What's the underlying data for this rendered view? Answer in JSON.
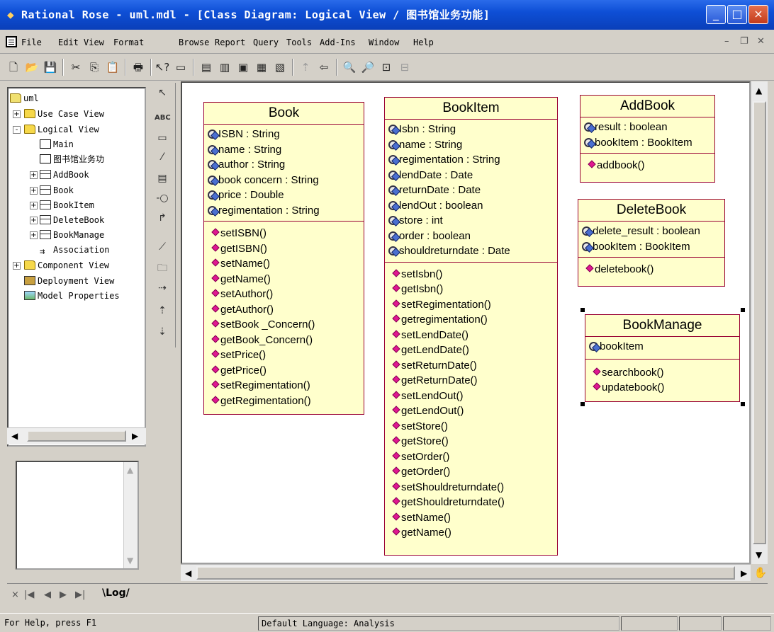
{
  "window": {
    "title": "Rational Rose - uml.mdl - [Class Diagram: Logical View / 图书馆业务功能]",
    "minimize": "_",
    "maximize": "□",
    "close": "×"
  },
  "menu": [
    "File",
    "Edit",
    "View",
    "Format",
    "Browse",
    "Report",
    "Query",
    "Tools",
    "Add-Ins",
    "Window",
    "Help"
  ],
  "toolbar_icons": [
    "new-icon",
    "open-icon",
    "save-icon",
    "cut-icon",
    "copy-icon",
    "paste-icon",
    "print-icon",
    "context-help-icon",
    "view-doc-icon",
    "browse-class-diagram-icon",
    "browse-interaction-diagram-icon",
    "browse-component-diagram-icon",
    "browse-deployment-diagram-icon",
    "browse-parent-icon",
    "browse-previous-icon",
    "zoom-in-icon",
    "zoom-out-icon",
    "fit-window-icon",
    "undo-fit-icon"
  ],
  "tree": {
    "root": "uml",
    "items": [
      {
        "label": "Use Case View",
        "type": "folder",
        "level": 1,
        "expander": "+"
      },
      {
        "label": "Logical View",
        "type": "folder",
        "level": 1,
        "expander": "-"
      },
      {
        "label": "Main",
        "type": "diagram",
        "level": 2
      },
      {
        "label": "图书馆业务功",
        "type": "diagram",
        "level": 2
      },
      {
        "label": "AddBook",
        "type": "class",
        "level": 2,
        "expander": "+"
      },
      {
        "label": "Book",
        "type": "class",
        "level": 2,
        "expander": "+"
      },
      {
        "label": "BookItem",
        "type": "class",
        "level": 2,
        "expander": "+"
      },
      {
        "label": "DeleteBook",
        "type": "class",
        "level": 2,
        "expander": "+"
      },
      {
        "label": "BookManage",
        "type": "class",
        "level": 2,
        "expander": "+"
      },
      {
        "label": "Association",
        "type": "association",
        "level": 2
      },
      {
        "label": "Component View",
        "type": "folder",
        "level": 1,
        "expander": "+"
      },
      {
        "label": "Deployment View",
        "type": "deploy",
        "level": 1
      },
      {
        "label": "Model Properties",
        "type": "props",
        "level": 1
      }
    ]
  },
  "palette": [
    "selection-arrow-icon",
    "text-tool-icon",
    "note-icon",
    "anchor-note-icon",
    "class-tool-icon",
    "interface-tool-icon",
    "unidirectional-association-icon",
    "association-class-icon",
    "package-tool-icon",
    "dependency-icon",
    "generalization-icon",
    "realization-icon"
  ],
  "classes": {
    "book": {
      "name": "Book",
      "attributes": [
        "ISBN : String",
        "name : String",
        "author : String",
        "book concern : String",
        "price : Double",
        "regimentation : String"
      ],
      "operations": [
        "setISBN()",
        "getISBN()",
        "setName()",
        "getName()",
        "setAuthor()",
        "getAuthor()",
        "setBook _Concern()",
        "getBook_Concern()",
        "setPrice()",
        "getPrice()",
        "setRegimentation()",
        "getRegimentation()"
      ]
    },
    "bookitem": {
      "name": "BookItem",
      "attributes": [
        "Isbn : String",
        "name : String",
        "regimentation : String",
        "lendDate : Date",
        "returnDate : Date",
        "lendOut : boolean",
        "store : int",
        "order : boolean",
        "shouldreturndate : Date"
      ],
      "operations": [
        "setIsbn()",
        "getIsbn()",
        "setRegimentation()",
        "getregimentation()",
        "setLendDate()",
        "getLendDate()",
        "setReturnDate()",
        "getReturnDate()",
        "setLendOut()",
        "getLendOut()",
        "setStore()",
        "getStore()",
        "setOrder()",
        "getOrder()",
        "setShouldreturndate()",
        "getShouldreturndate()",
        "setName()",
        "getName()"
      ]
    },
    "addbook": {
      "name": "AddBook",
      "attributes": [
        "result : boolean",
        "bookItem : BookItem"
      ],
      "operations": [
        "addbook()"
      ]
    },
    "deletebook": {
      "name": "DeleteBook",
      "attributes": [
        "delete_result : boolean",
        "bookItem : BookItem"
      ],
      "operations": [
        "deletebook()"
      ]
    },
    "bookmanage": {
      "name": "BookManage",
      "attributes": [
        "bookItem"
      ],
      "operations": [
        "searchbook()",
        "updatebook()"
      ]
    }
  },
  "log_tab": "Log/",
  "status": {
    "help": "For Help, press F1",
    "language": "Default Language: Analysis"
  }
}
